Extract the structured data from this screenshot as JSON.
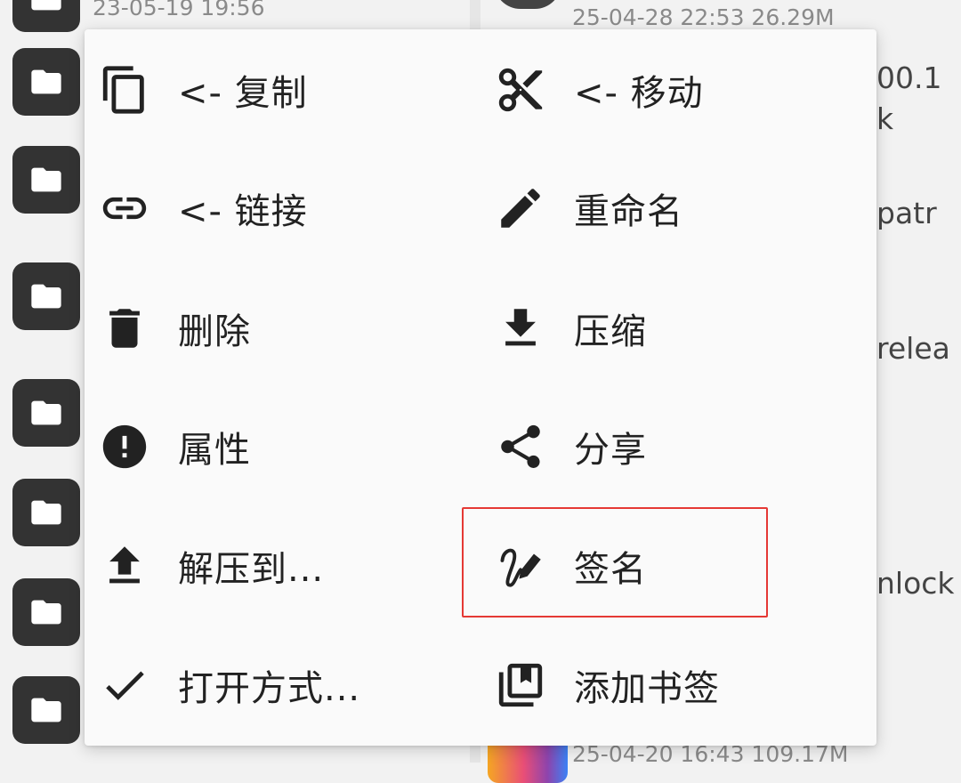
{
  "background": {
    "left_timestamp_top": "23-05-19 19:56",
    "right_meta_top": "25-04-28 22:53  26.29M",
    "right_meta_bottom": "25-04-20 16:43  109.17M",
    "right_fragments": [
      "00.1",
      "k",
      "patr",
      "relea",
      "nlock"
    ]
  },
  "menu": {
    "left": [
      {
        "id": "copy",
        "label": "<- 复制",
        "icon": "copy-icon"
      },
      {
        "id": "link",
        "label": "<- 链接",
        "icon": "link-icon"
      },
      {
        "id": "delete",
        "label": "删除",
        "icon": "trash-icon"
      },
      {
        "id": "properties",
        "label": "属性",
        "icon": "info-icon"
      },
      {
        "id": "extract-to",
        "label": "解压到...",
        "icon": "upload-icon"
      },
      {
        "id": "open-with",
        "label": "打开方式...",
        "icon": "check-icon"
      }
    ],
    "right": [
      {
        "id": "move",
        "label": "<- 移动",
        "icon": "scissors-icon"
      },
      {
        "id": "rename",
        "label": "重命名",
        "icon": "pencil-icon"
      },
      {
        "id": "compress",
        "label": "压缩",
        "icon": "download-icon"
      },
      {
        "id": "share",
        "label": "分享",
        "icon": "share-icon"
      },
      {
        "id": "sign",
        "label": "签名",
        "icon": "signature-icon"
      },
      {
        "id": "add-bookmark",
        "label": "添加书签",
        "icon": "bookmark-library-icon"
      }
    ]
  },
  "highlight": {
    "target": "sign",
    "color": "#e53935"
  },
  "colors": {
    "icon": "#222222",
    "menu_bg": "#fafafa",
    "folder_tile": "#333333"
  }
}
